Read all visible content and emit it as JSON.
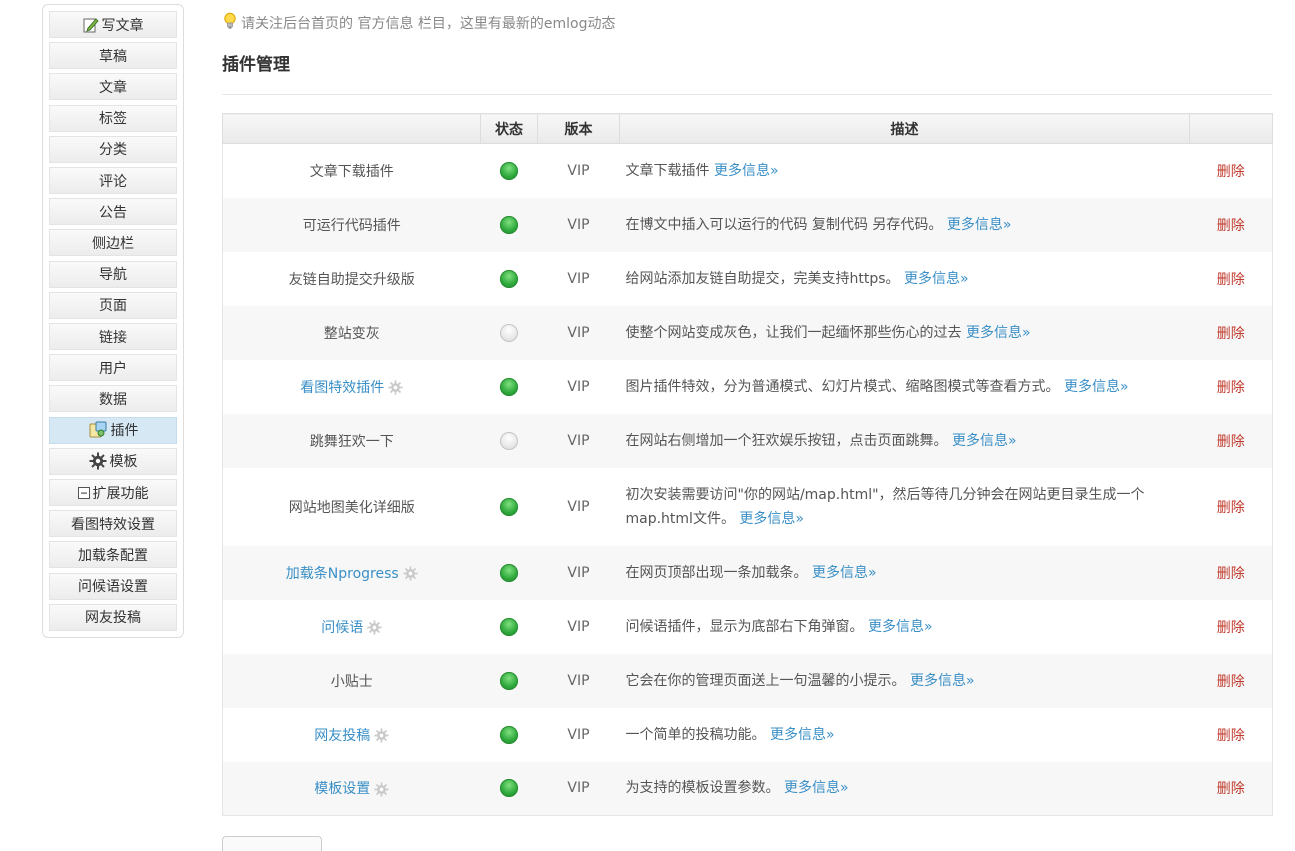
{
  "sidebar": {
    "items": [
      {
        "label": "写文章",
        "icon": "write-icon"
      },
      {
        "label": "草稿"
      },
      {
        "label": "文章"
      },
      {
        "label": "标签"
      },
      {
        "label": "分类"
      },
      {
        "label": "评论"
      },
      {
        "label": "公告"
      },
      {
        "label": "侧边栏"
      },
      {
        "label": "导航"
      },
      {
        "label": "页面"
      },
      {
        "label": "链接"
      },
      {
        "label": "用户"
      },
      {
        "label": "数据"
      },
      {
        "label": "插件",
        "icon": "plugin-icon",
        "active": true
      },
      {
        "label": "模板",
        "icon": "gear-icon"
      },
      {
        "label": "扩展功能",
        "icon": "minus-box-icon"
      },
      {
        "label": "看图特效设置"
      },
      {
        "label": "加载条配置"
      },
      {
        "label": "问候语设置"
      },
      {
        "label": "网友投稿"
      }
    ]
  },
  "tip": {
    "text": "请关注后台首页的 官方信息 栏目，这里有最新的emlog动态",
    "icon": "lightbulb-icon"
  },
  "page_title": "插件管理",
  "table": {
    "headers": [
      "",
      "状态",
      "版本",
      "描述",
      ""
    ],
    "more_label": "更多信息»",
    "delete_label": "删除",
    "rows": [
      {
        "name": "文章下载插件",
        "status": "on",
        "version": "VIP",
        "desc": "文章下载插件",
        "has_settings": false
      },
      {
        "name": "可运行代码插件",
        "status": "on",
        "version": "VIP",
        "desc": "在博文中插入可以运行的代码 复制代码 另存代码。",
        "has_settings": false
      },
      {
        "name": "友链自助提交升级版",
        "status": "on",
        "version": "VIP",
        "desc": "给网站添加友链自助提交，完美支持https。",
        "has_settings": false
      },
      {
        "name": "整站变灰",
        "status": "off",
        "version": "VIP",
        "desc": "使整个网站变成灰色，让我们一起缅怀那些伤心的过去",
        "has_settings": false
      },
      {
        "name": "看图特效插件",
        "status": "on",
        "version": "VIP",
        "desc": "图片插件特效，分为普通模式、幻灯片模式、缩略图模式等查看方式。",
        "has_settings": true
      },
      {
        "name": "跳舞狂欢一下",
        "status": "off",
        "version": "VIP",
        "desc": "在网站右侧增加一个狂欢娱乐按钮，点击页面跳舞。",
        "has_settings": false
      },
      {
        "name": "网站地图美化详细版",
        "status": "on",
        "version": "VIP",
        "desc": "初次安装需要访问\"你的网站/map.html\"，然后等待几分钟会在网站更目录生成一个map.html文件。",
        "has_settings": false
      },
      {
        "name": "加载条Nprogress",
        "status": "on",
        "version": "VIP",
        "desc": "在网页顶部出现一条加载条。",
        "has_settings": true
      },
      {
        "name": "问候语",
        "status": "on",
        "version": "VIP",
        "desc": "问候语插件，显示为底部右下角弹窗。",
        "has_settings": true
      },
      {
        "name": "小贴士",
        "status": "on",
        "version": "VIP",
        "desc": "它会在你的管理页面送上一句温馨的小提示。",
        "has_settings": false
      },
      {
        "name": "网友投稿",
        "status": "on",
        "version": "VIP",
        "desc": "一个简单的投稿功能。",
        "has_settings": true
      },
      {
        "name": "模板设置",
        "status": "on",
        "version": "VIP",
        "desc": "为支持的模板设置参数。",
        "has_settings": true
      }
    ]
  },
  "colors": {
    "link": "#3a8fc7",
    "delete": "#c0392b",
    "status_on": "#2faa3c",
    "active_nav": "#d7e8f5"
  }
}
